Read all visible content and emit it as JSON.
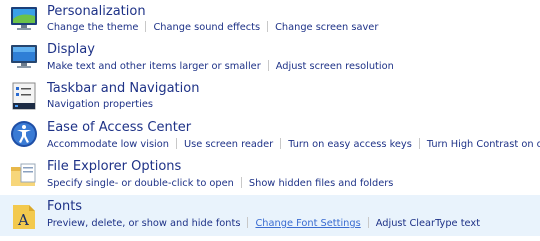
{
  "categories": [
    {
      "key": "personalization",
      "title": "Personalization",
      "links": [
        "Change the theme",
        "Change sound effects",
        "Change screen saver"
      ]
    },
    {
      "key": "display",
      "title": "Display",
      "links": [
        "Make text and other items larger or smaller",
        "Adjust screen resolution"
      ]
    },
    {
      "key": "taskbar",
      "title": "Taskbar and Navigation",
      "links": [
        "Navigation properties"
      ]
    },
    {
      "key": "ease",
      "title": "Ease of Access Center",
      "links": [
        "Accommodate low vision",
        "Use screen reader",
        "Turn on easy access keys",
        "Turn High Contrast on or off"
      ]
    },
    {
      "key": "explorer",
      "title": "File Explorer Options",
      "links": [
        "Specify single- or double-click to open",
        "Show hidden files and folders"
      ]
    },
    {
      "key": "fonts",
      "title": "Fonts",
      "links": [
        "Preview, delete, or show and hide fonts",
        "Change Font Settings",
        "Adjust ClearType text"
      ]
    }
  ],
  "icons": [
    "personalization-icon",
    "display-icon",
    "taskbar-icon",
    "ease-of-access-icon",
    "file-explorer-options-icon",
    "fonts-icon"
  ]
}
